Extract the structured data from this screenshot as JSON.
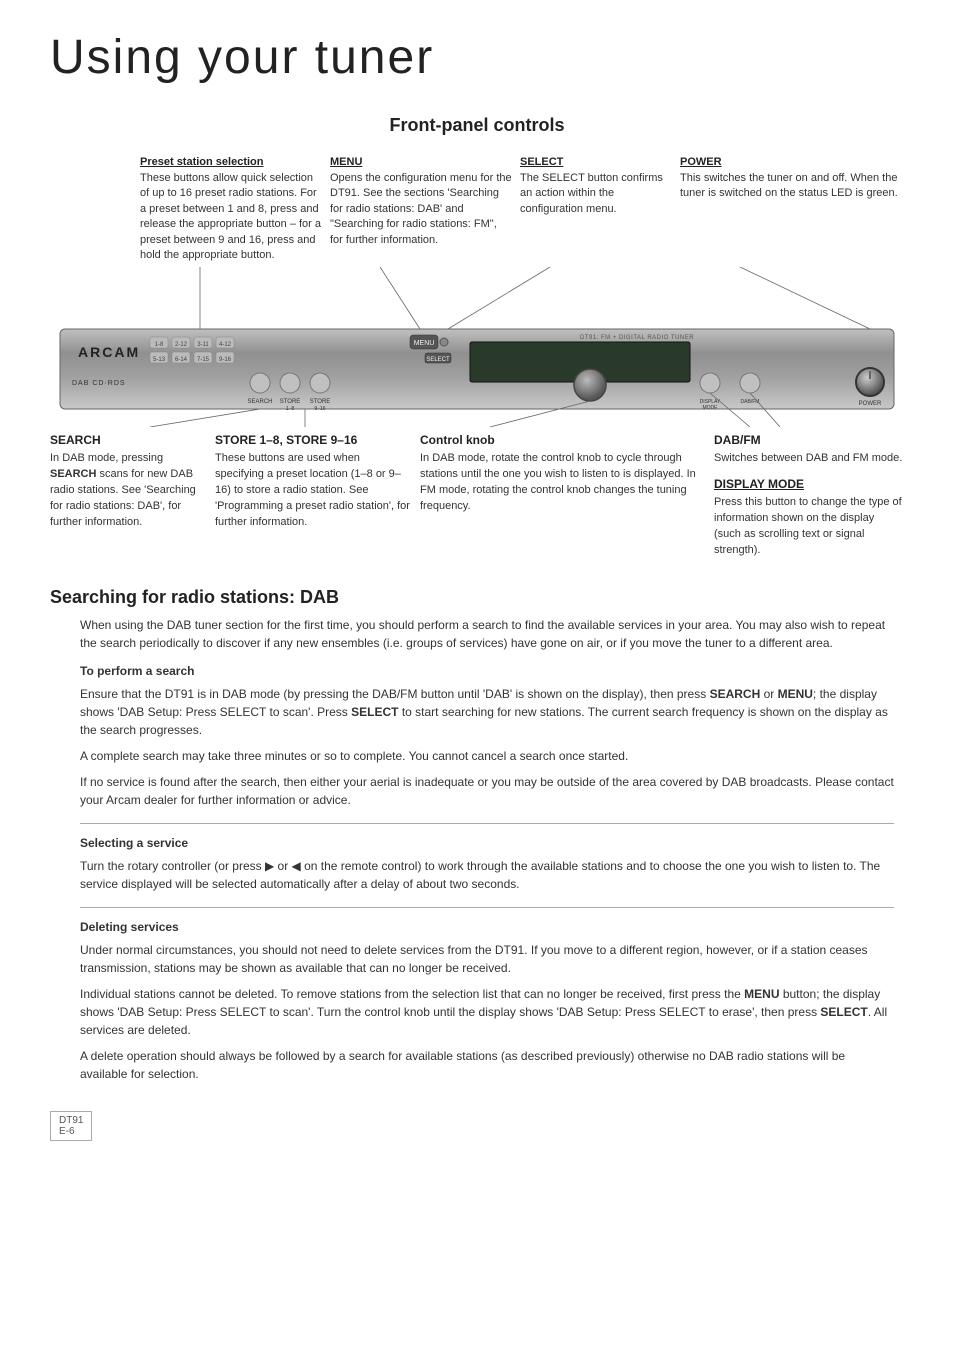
{
  "page": {
    "title": "Using your tuner",
    "section1": {
      "title": "Front-panel controls"
    },
    "section2": {
      "title": "Searching for radio stations: DAB"
    }
  },
  "annotations_top": {
    "preset": {
      "label": "Preset station selection",
      "text": "These buttons allow quick selection of up to 16 preset radio stations. For a preset between 1 and 8, press and release the appropriate button – for a preset between 9 and 16, press and hold the appropriate button."
    },
    "menu": {
      "label": "MENU",
      "text": "Opens the configuration menu for the DT91. See the sections 'Searching for radio stations: DAB' and \"Searching for radio stations: FM\", for further information."
    },
    "select": {
      "label": "SELECT",
      "text": "The SELECT button confirms an action within the configuration menu."
    },
    "power": {
      "label": "POWER",
      "text": "This switches the tuner on and off. When the tuner is switched on the status LED is green."
    }
  },
  "callouts_bottom": {
    "search": {
      "label": "SEARCH",
      "text": "In DAB mode, pressing SEARCH scans for new DAB radio stations. See 'Searching for radio stations: DAB', for further information."
    },
    "store": {
      "label": "STORE 1–8, STORE 9–16",
      "text": "These buttons are used when specifying a preset location (1–8 or 9–16) to store a radio station. See 'Programming a preset radio station', for further information."
    },
    "control_knob": {
      "label": "Control knob",
      "text": "In DAB mode, rotate the control knob to cycle through stations until the one you wish to listen to is displayed. In FM mode, rotating the control knob changes the tuning frequency."
    },
    "dab_fm": {
      "label": "DAB/FM",
      "text": "Switches between DAB and FM mode."
    },
    "display_mode": {
      "label": "DISPLAY MODE",
      "text": "Press this button to change the type of information shown on the display (such as scrolling text or signal strength)."
    }
  },
  "tuner": {
    "brand": "ARCAM",
    "sub_brand": "DAB CD·RDS",
    "model": "DT91: FM + DIGITAL RADIO TUNER",
    "preset_labels": [
      "1-8",
      "2-12",
      "3-11",
      "4-12",
      "5-13",
      "6-14",
      "7-15",
      "9-16"
    ],
    "buttons": {
      "menu": "MENU",
      "select": "SELECT",
      "search": "SEARCH",
      "store_1_8": "STORE 1-8",
      "store_9_16": "STORE 9-16",
      "display_mode": "DISPLAY MODE",
      "dab_fm": "DAB/FM",
      "power": "POWER"
    }
  },
  "dab_section": {
    "intro": "When using the DAB tuner section for the first time, you should perform a search to find the available services in your area. You may also wish to repeat the search periodically to discover if any new ensembles (i.e. groups of services) have gone on air, or if you move the tuner to a different area.",
    "perform_search": {
      "title": "To perform a search",
      "para1": "Ensure that the DT91 is in DAB mode (by pressing the DAB/FM button until 'DAB' is shown on the display), then press SEARCH or MENU; the display shows 'DAB Setup: Press SELECT to scan'. Press SELECT to start searching for new stations. The current search frequency is shown on the display as the search progresses.",
      "para2": "A complete search may take three minutes or so to complete. You cannot cancel a search once started.",
      "para3": "If no service is found after the search, then either your aerial is inadequate or you may be outside of the area covered by DAB broadcasts. Please contact your Arcam dealer for further information or advice."
    },
    "selecting_service": {
      "title": "Selecting a service",
      "text": "Turn the rotary controller (or press ▶ or ◀ on the remote control) to work through the available stations and to choose the one you wish to listen to. The service displayed will be selected automatically after a delay of about two seconds."
    },
    "deleting_services": {
      "title": "Deleting services",
      "para1": "Under normal circumstances, you should not need to delete services from the DT91. If you move to a different region, however, or if a station ceases transmission, stations may be shown as available that can no longer be received.",
      "para2": "Individual stations cannot be deleted. To remove stations from the selection list that can no longer be received, first press the MENU button; the display shows 'DAB Setup: Press SELECT to scan'. Turn the control knob until the display shows 'DAB Setup: Press SELECT to erase', then press SELECT. All services are deleted.",
      "para3": "A delete operation should always be followed by a search for available stations (as described previously) otherwise no DAB radio stations will be available for selection."
    }
  },
  "footer": {
    "model": "DT91",
    "page": "E-6"
  }
}
